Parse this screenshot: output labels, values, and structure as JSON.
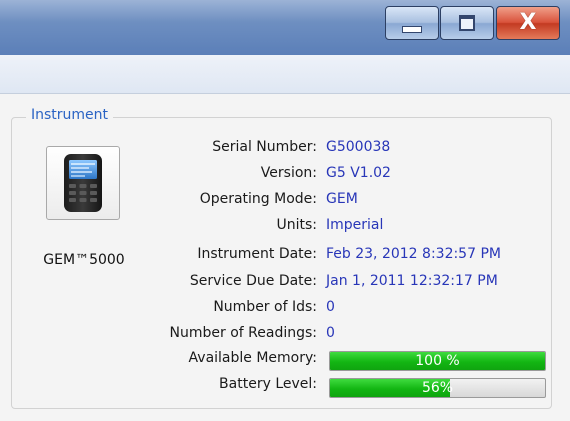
{
  "window": {
    "controls": {
      "minimize_icon": "minimize-icon",
      "maximize_icon": "maximize-icon",
      "close_glyph": "X"
    },
    "accent": "#2a63c4"
  },
  "instrument": {
    "group_title": "Instrument",
    "device_name": "GEM™5000",
    "fields": {
      "serial_label": "Serial Number:",
      "serial_value": "G500038",
      "version_label": "Version:",
      "version_value": "G5 V1.02",
      "mode_label": "Operating Mode:",
      "mode_value": "GEM",
      "units_label": "Units:",
      "units_value": "Imperial",
      "inst_date_label": "Instrument Date:",
      "inst_date_value": "Feb 23, 2012 8:32:57 PM",
      "service_label": "Service Due Date:",
      "service_value": "Jan 1, 2011 12:32:17 PM",
      "ids_label": "Number of Ids:",
      "ids_value": "0",
      "readings_label": "Number of Readings:",
      "readings_value": "0",
      "memory_label": "Available Memory:",
      "memory_text": "100 %",
      "memory_percent": 100,
      "battery_label": "Battery Level:",
      "battery_text": "56%",
      "battery_percent": 56
    },
    "colors": {
      "value_text": "#2836b8",
      "progress_fill": "#13b613"
    }
  }
}
